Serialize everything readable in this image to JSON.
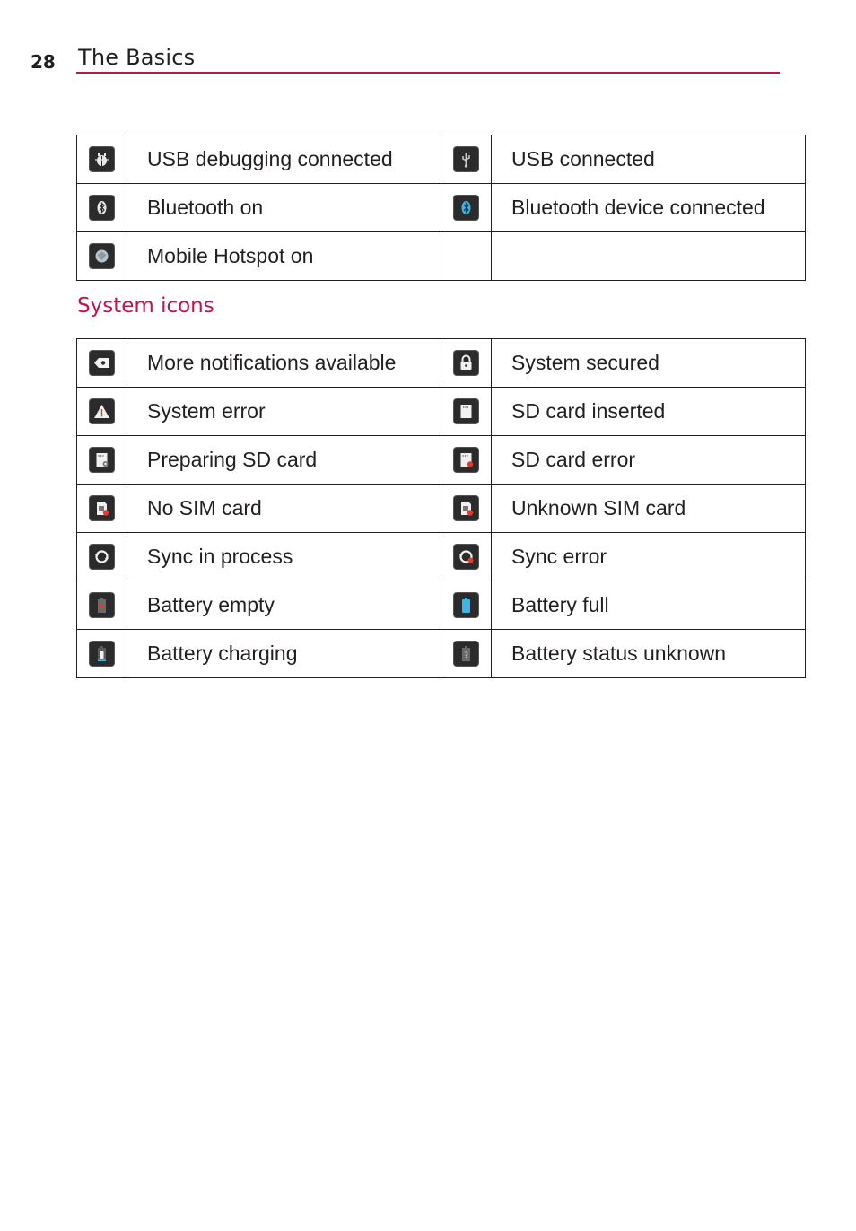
{
  "header": {
    "page_number": "28",
    "title": "The Basics"
  },
  "table1": {
    "rows": [
      {
        "left": {
          "icon": "usb-debugging-icon",
          "label": "USB debugging connected"
        },
        "right": {
          "icon": "usb-icon",
          "label": "USB connected"
        }
      },
      {
        "left": {
          "icon": "bluetooth-icon",
          "label": "Bluetooth on"
        },
        "right": {
          "icon": "bluetooth-connected-icon",
          "label": "Bluetooth device connected"
        }
      },
      {
        "left": {
          "icon": "hotspot-icon",
          "label": "Mobile Hotspot on"
        },
        "right": {
          "icon": "",
          "label": ""
        }
      }
    ]
  },
  "section": {
    "heading": "System icons"
  },
  "table2": {
    "rows": [
      {
        "left": {
          "icon": "more-notifications-icon",
          "label": "More notifications available"
        },
        "right": {
          "icon": "lock-icon",
          "label": "System secured"
        }
      },
      {
        "left": {
          "icon": "warning-icon",
          "label": "System error"
        },
        "right": {
          "icon": "sd-card-icon",
          "label": "SD card inserted"
        }
      },
      {
        "left": {
          "icon": "sd-card-preparing-icon",
          "label": "Preparing SD card"
        },
        "right": {
          "icon": "sd-card-error-icon",
          "label": "SD card error"
        }
      },
      {
        "left": {
          "icon": "no-sim-icon",
          "label": "No SIM card"
        },
        "right": {
          "icon": "unknown-sim-icon",
          "label": "Unknown SIM card"
        }
      },
      {
        "left": {
          "icon": "sync-icon",
          "label": "Sync in process"
        },
        "right": {
          "icon": "sync-error-icon",
          "label": "Sync error"
        }
      },
      {
        "left": {
          "icon": "battery-empty-icon",
          "label": "Battery empty"
        },
        "right": {
          "icon": "battery-full-icon",
          "label": "Battery full"
        }
      },
      {
        "left": {
          "icon": "battery-charging-icon",
          "label": "Battery charging"
        },
        "right": {
          "icon": "battery-unknown-icon",
          "label": "Battery status unknown"
        }
      }
    ]
  },
  "colors": {
    "accent": "#c3124e",
    "text": "#231f20",
    "icon_bg": "#2b2b2b",
    "bluetooth_blue": "#3bb6e6",
    "error_red": "#e53b2c"
  }
}
